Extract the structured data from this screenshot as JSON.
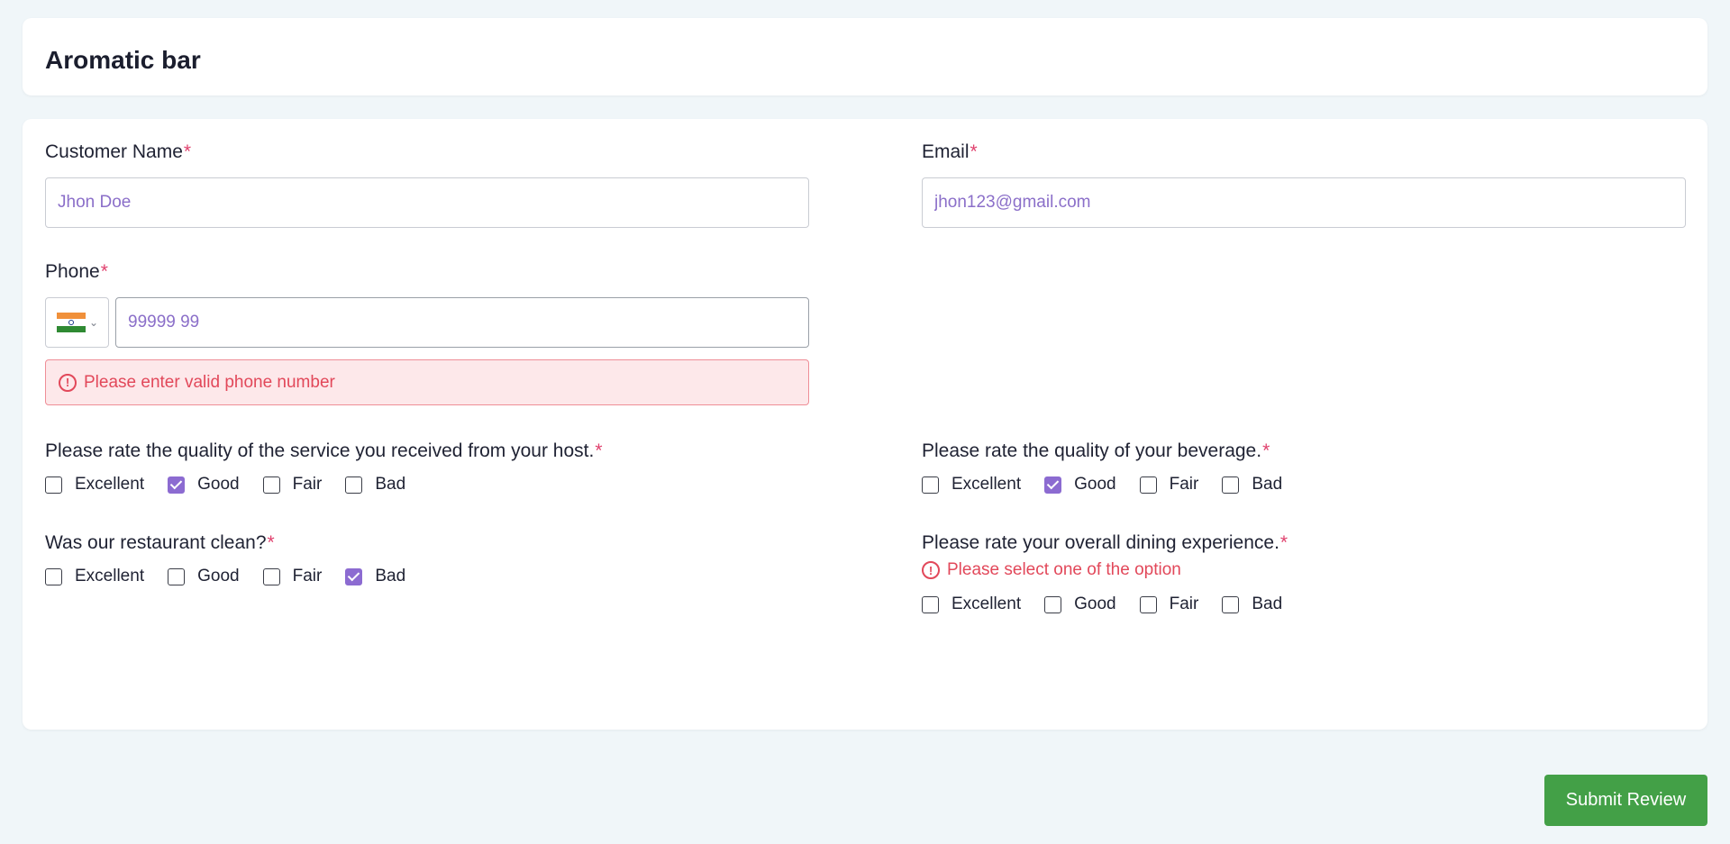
{
  "header": {
    "title": "Aromatic bar"
  },
  "form": {
    "customer_name": {
      "label": "Customer Name",
      "required_mark": "*",
      "value": "Jhon Doe"
    },
    "email": {
      "label": "Email",
      "required_mark": "*",
      "value": "jhon123@gmail.com"
    },
    "phone": {
      "label": "Phone",
      "required_mark": "*",
      "value": "99999 99",
      "country_flag": "india-flag-icon",
      "error": "Please enter valid phone number"
    },
    "questions": [
      {
        "label": "Please rate the quality of the service you received from your host.",
        "required_mark": "*",
        "selected": "Good"
      },
      {
        "label": "Please rate the quality of your beverage.",
        "required_mark": "*",
        "selected": "Good"
      },
      {
        "label": "Was our restaurant clean?",
        "required_mark": "*",
        "selected": "Bad"
      },
      {
        "label": "Please rate your overall dining experience.",
        "required_mark": "*",
        "selected": null,
        "error": "Please select one of the option"
      }
    ],
    "options": [
      "Excellent",
      "Good",
      "Fair",
      "Bad"
    ]
  },
  "actions": {
    "submit_label": "Submit Review"
  },
  "colors": {
    "accent": "#8c6bd1",
    "error": "#e2485a",
    "required": "#e0426e",
    "submit": "#43a047",
    "background": "#f0f6f9"
  }
}
